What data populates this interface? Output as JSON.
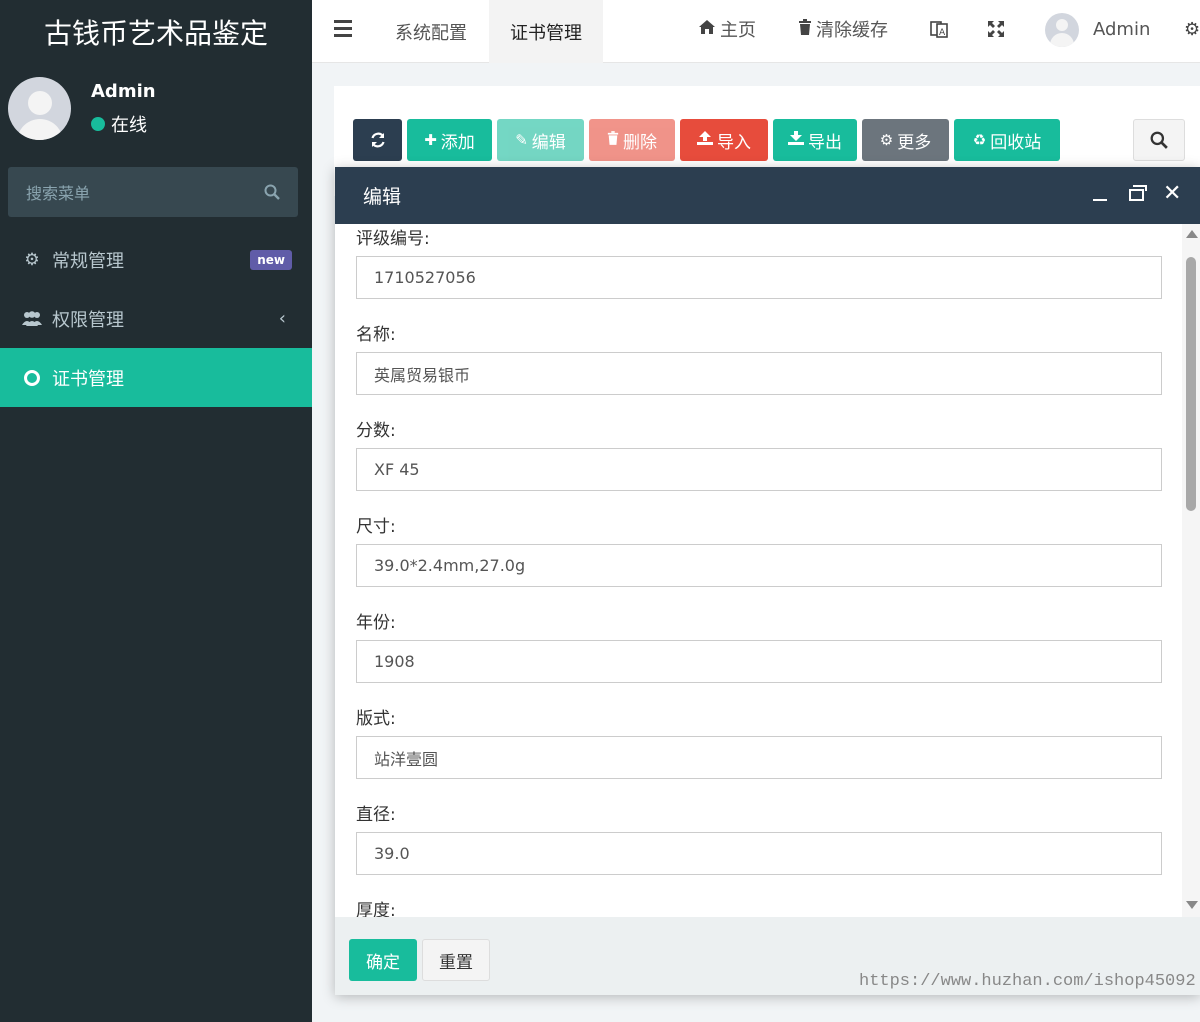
{
  "app": {
    "title": "古钱币艺术品鉴定"
  },
  "user": {
    "name": "Admin",
    "status": "在线"
  },
  "sidebar": {
    "search_placeholder": "搜索菜单",
    "items": [
      {
        "label": "常规管理",
        "icon": "gears-icon",
        "badge": "new"
      },
      {
        "label": "权限管理",
        "icon": "users-icon",
        "chevron": "‹"
      },
      {
        "label": "证书管理",
        "icon": "circle-icon"
      }
    ]
  },
  "topbar": {
    "tabs": [
      "系统配置",
      "证书管理"
    ],
    "home": "主页",
    "clear_cache": "清除缓存",
    "user": "Admin"
  },
  "toolbar": {
    "add": "添加",
    "edit": "编辑",
    "delete": "删除",
    "import": "导入",
    "export": "导出",
    "more": "更多",
    "recycle": "回收站"
  },
  "colors": {
    "primary_dark": "#2c3e50",
    "success": "#18bc9c",
    "danger": "#e74c3c",
    "gray": "#6c757d"
  },
  "dialog": {
    "title": "编辑",
    "fields": [
      {
        "label": "评级编号:",
        "value": "1710527056"
      },
      {
        "label": "名称:",
        "value": "英属贸易银币"
      },
      {
        "label": "分数:",
        "value": "XF 45"
      },
      {
        "label": "尺寸:",
        "value": "39.0*2.4mm,27.0g"
      },
      {
        "label": "年份:",
        "value": "1908"
      },
      {
        "label": "版式:",
        "value": "站洋壹圆"
      },
      {
        "label": "直径:",
        "value": "39.0"
      },
      {
        "label": "厚度:",
        "value": ""
      }
    ],
    "confirm": "确定",
    "reset": "重置"
  },
  "watermark": "https://www.huzhan.com/ishop45092"
}
